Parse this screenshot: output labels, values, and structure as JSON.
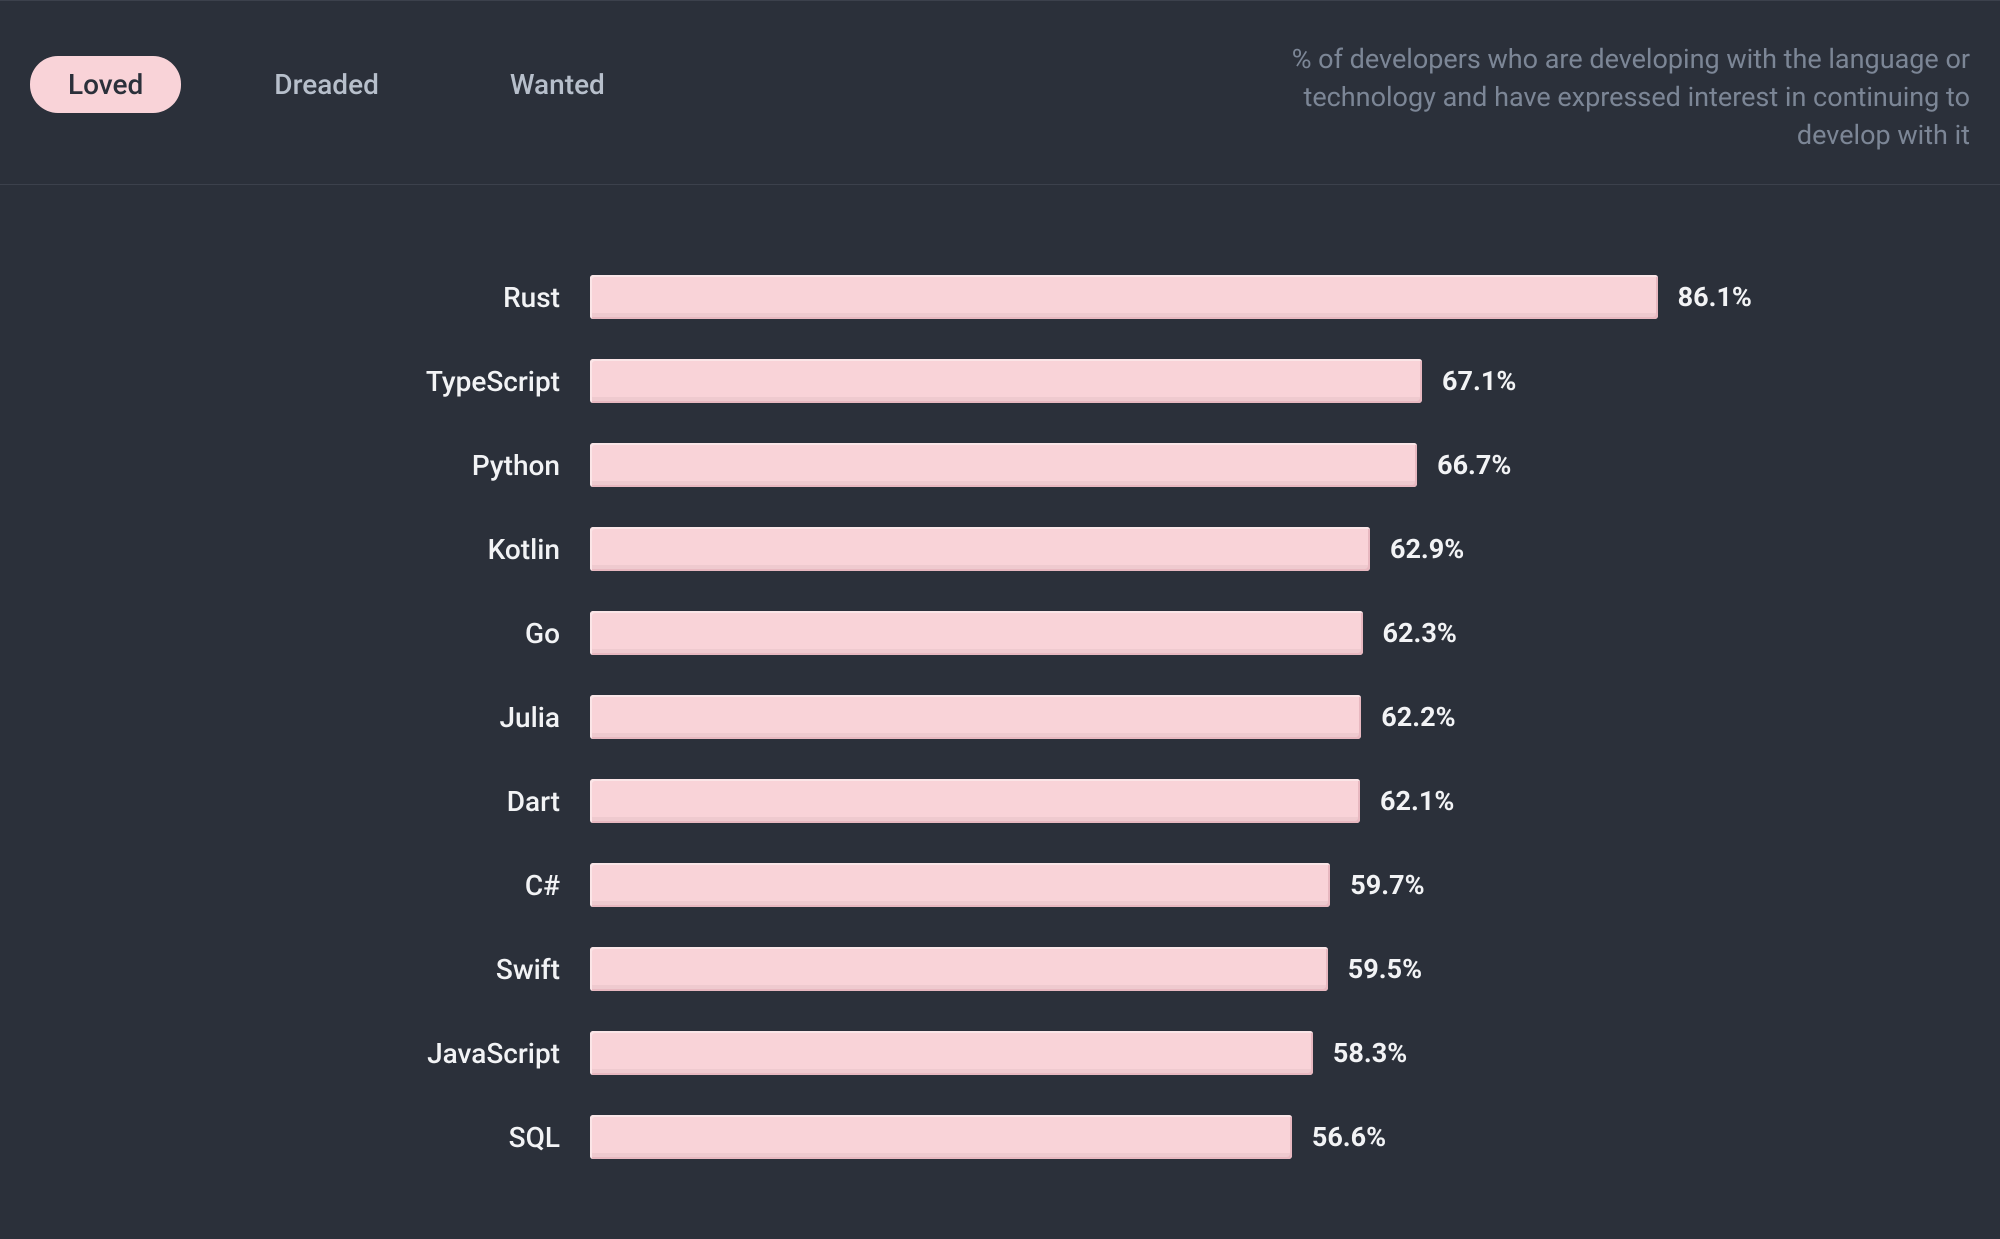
{
  "tabs": [
    {
      "label": "Loved",
      "active": true
    },
    {
      "label": "Dreaded",
      "active": false
    },
    {
      "label": "Wanted",
      "active": false
    }
  ],
  "description": "% of developers who are developing with the language or technology and have expressed interest in continuing to develop with it",
  "colors": {
    "background": "#2b303a",
    "bar": "#f9d3d8",
    "text": "#f2f3f5",
    "muted": "#7c8696"
  },
  "chart_data": {
    "type": "bar",
    "orientation": "horizontal",
    "title": "",
    "xlabel": "",
    "ylabel": "",
    "xlim": [
      0,
      100
    ],
    "unit": "%",
    "categories": [
      "Rust",
      "TypeScript",
      "Python",
      "Kotlin",
      "Go",
      "Julia",
      "Dart",
      "C#",
      "Swift",
      "JavaScript",
      "SQL"
    ],
    "values": [
      86.1,
      67.1,
      66.7,
      62.9,
      62.3,
      62.2,
      62.1,
      59.7,
      59.5,
      58.3,
      56.6
    ]
  }
}
